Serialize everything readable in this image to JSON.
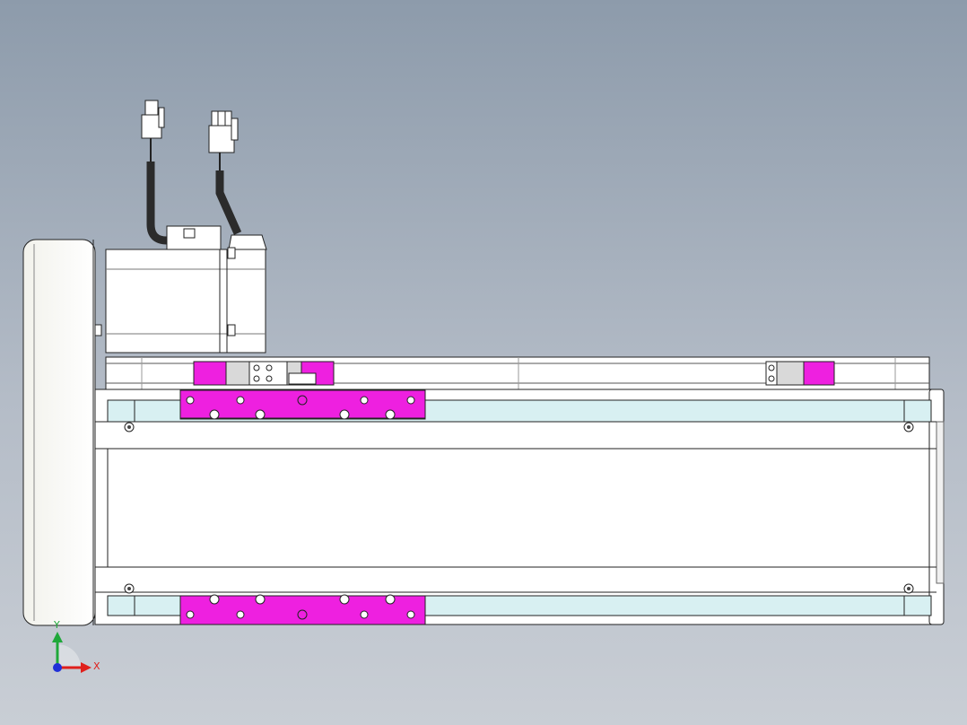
{
  "triad": {
    "x_label": "X",
    "y_label": "Y",
    "x_color": "#e0201c",
    "y_color": "#1fa83a",
    "z_color": "#2030d8"
  },
  "colors": {
    "highlight": "#ee20e0",
    "metal": "#ffffff",
    "glass": "#d8f0f2",
    "cable": "#2b2b2b",
    "outline": "#222222"
  }
}
